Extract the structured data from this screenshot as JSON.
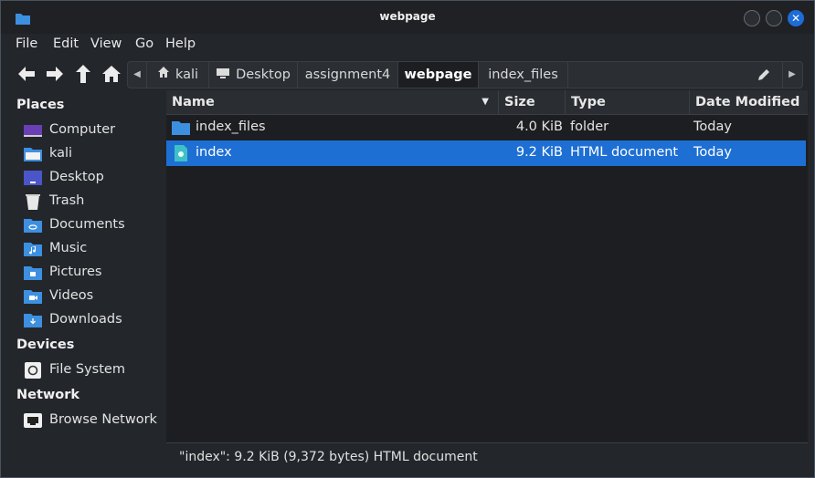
{
  "window": {
    "title": "webpage"
  },
  "menu": [
    "File",
    "Edit",
    "View",
    "Go",
    "Help"
  ],
  "toolbar": {
    "nav_icons": [
      "back-arrow-icon",
      "forward-arrow-icon",
      "up-arrow-icon",
      "home-icon"
    ],
    "breadcrumbs": [
      {
        "label": "kali",
        "icon": "home-icon"
      },
      {
        "label": "Desktop",
        "icon": "desktop-icon"
      },
      {
        "label": "assignment4"
      },
      {
        "label": "webpage",
        "active": true
      },
      {
        "label": "index_files"
      }
    ]
  },
  "sidebar": {
    "places_header": "Places",
    "places": [
      {
        "label": "Computer",
        "icon": "computer-icon"
      },
      {
        "label": "kali",
        "icon": "home-folder-icon"
      },
      {
        "label": "Desktop",
        "icon": "desktop-icon"
      },
      {
        "label": "Trash",
        "icon": "trash-icon"
      },
      {
        "label": "Documents",
        "icon": "documents-folder-icon"
      },
      {
        "label": "Music",
        "icon": "music-folder-icon"
      },
      {
        "label": "Pictures",
        "icon": "pictures-folder-icon"
      },
      {
        "label": "Videos",
        "icon": "videos-folder-icon"
      },
      {
        "label": "Downloads",
        "icon": "downloads-folder-icon"
      }
    ],
    "devices_header": "Devices",
    "devices": [
      {
        "label": "File System",
        "icon": "drive-icon"
      }
    ],
    "network_header": "Network",
    "network": [
      {
        "label": "Browse Network",
        "icon": "network-icon"
      }
    ]
  },
  "columns": {
    "name": "Name",
    "size": "Size",
    "type": "Type",
    "date": "Date Modified"
  },
  "files": [
    {
      "name": "index_files",
      "size": "4.0 KiB",
      "type": "folder",
      "date": "Today",
      "icon": "folder-icon",
      "selected": false
    },
    {
      "name": "index",
      "size": "9.2 KiB",
      "type": "HTML document",
      "date": "Today",
      "icon": "html-file-icon",
      "selected": true
    }
  ],
  "status": "\"index\": 9.2 KiB (9,372 bytes) HTML document",
  "colors": {
    "accent": "#1d6fd3",
    "folder": "#3d8fe0",
    "background": "#23262b"
  }
}
